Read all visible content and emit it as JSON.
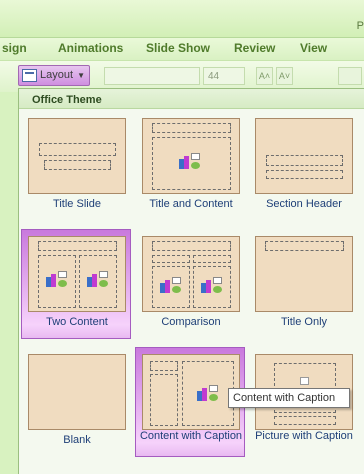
{
  "titlebar": {
    "caption": "P"
  },
  "tabs": [
    "sign",
    "Animations",
    "Slide Show",
    "Review",
    "View"
  ],
  "ribbon": {
    "layout_label": "Layout",
    "font_size": "44",
    "grow_font": "A˄",
    "shrink_font": "A˅"
  },
  "gallery": {
    "header": "Office Theme",
    "items": [
      {
        "label": "Title Slide",
        "selected": false
      },
      {
        "label": "Title and Content",
        "selected": false
      },
      {
        "label": "Section Header",
        "selected": false
      },
      {
        "label": "Two Content",
        "selected": true
      },
      {
        "label": "Comparison",
        "selected": false
      },
      {
        "label": "Title Only",
        "selected": false
      },
      {
        "label": "Blank",
        "selected": false
      },
      {
        "label": "Content with Caption",
        "selected": true
      },
      {
        "label": "Picture with Caption",
        "selected": false
      }
    ]
  },
  "tooltip": {
    "text": "Content with Caption"
  },
  "colors": {
    "accent_selected": "#c979dd",
    "thumb_bg": "#f0dcc0",
    "label_text": "#1e3f77"
  }
}
